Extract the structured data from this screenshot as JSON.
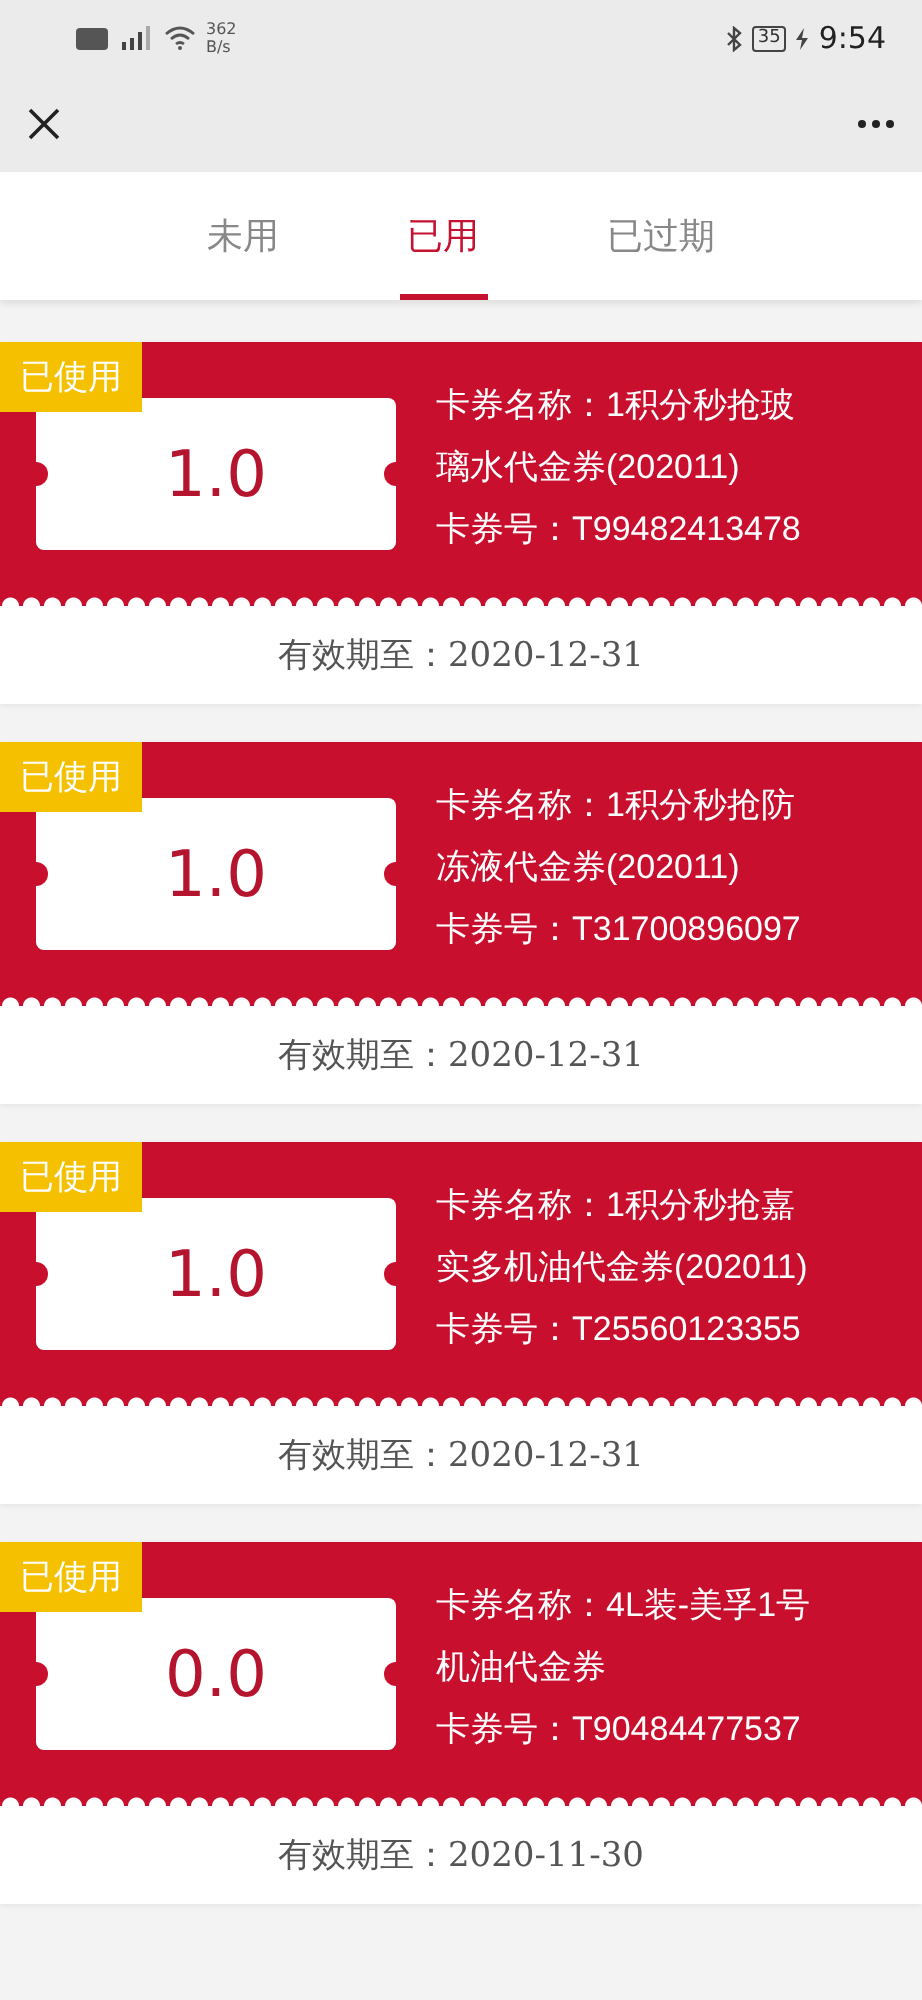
{
  "status_bar": {
    "network_speed": "362",
    "speed_unit": "B/s",
    "battery": "35",
    "time": "9:54"
  },
  "tabs": [
    {
      "label": "未用",
      "selected": false
    },
    {
      "label": "已用",
      "selected": true
    },
    {
      "label": "已过期",
      "selected": false
    }
  ],
  "coupons": [
    {
      "badge": "已使用",
      "amount": "1.0",
      "name": "卡券名称：1积分秒抢玻璃水代金券(202011)",
      "number": "卡券号：T99482413478",
      "validity": "有效期至：2020-12-31"
    },
    {
      "badge": "已使用",
      "amount": "1.0",
      "name": "卡券名称：1积分秒抢防冻液代金券(202011)",
      "number": "卡券号：T31700896097",
      "validity": "有效期至：2020-12-31"
    },
    {
      "badge": "已使用",
      "amount": "1.0",
      "name": "卡券名称：1积分秒抢嘉实多机油代金券(202011)",
      "number": "卡券号：T25560123355",
      "validity": "有效期至：2020-12-31"
    },
    {
      "badge": "已使用",
      "amount": "0.0",
      "name": "卡券名称：4L装-美孚1号机油代金券",
      "number": "卡券号：T90484477537",
      "validity": "有效期至：2020-11-30"
    }
  ]
}
